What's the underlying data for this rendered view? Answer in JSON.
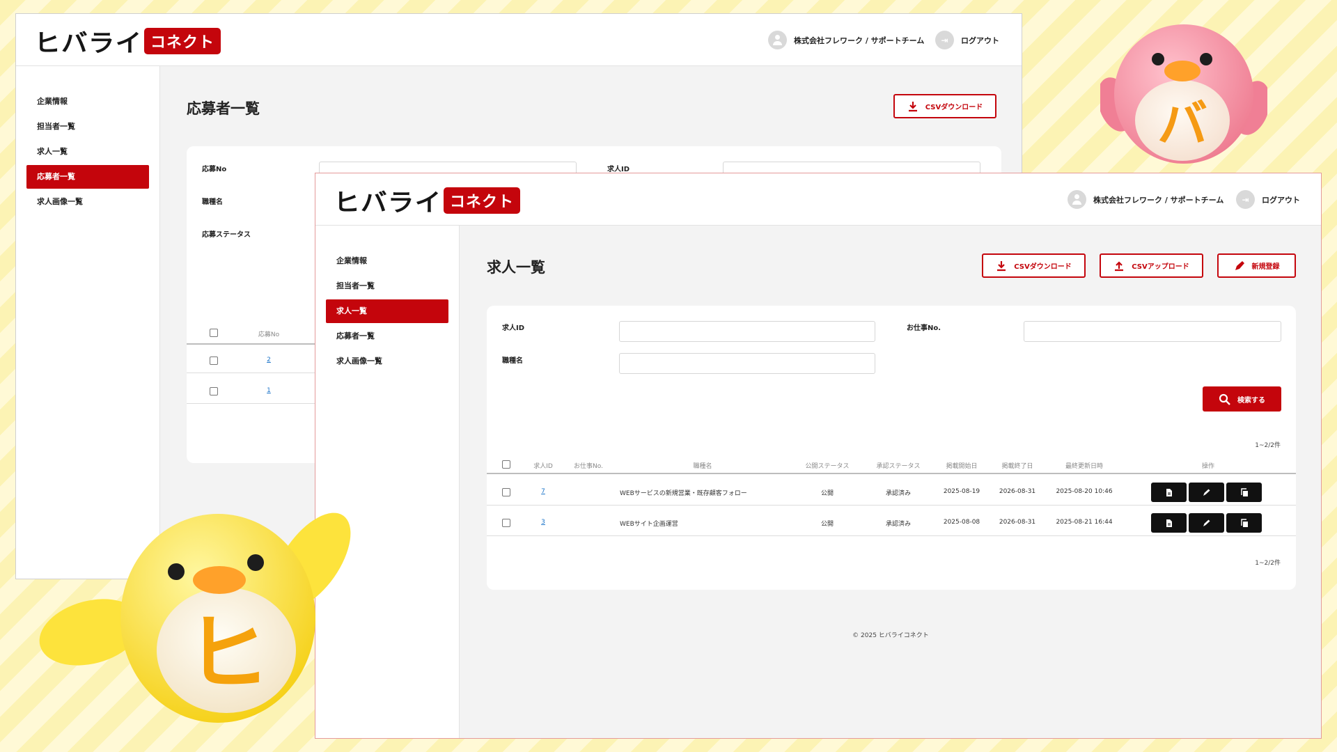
{
  "brand": {
    "name": "ヒバライ",
    "badge": "コネクト",
    "accent": "#c4050c"
  },
  "header": {
    "company": "株式会社フレワーク / サポートチーム",
    "logout": "ログアウト"
  },
  "sidebar": {
    "items": [
      {
        "label": "企業情報"
      },
      {
        "label": "担当者一覧"
      },
      {
        "label": "求人一覧"
      },
      {
        "label": "応募者一覧"
      },
      {
        "label": "求人画像一覧"
      }
    ]
  },
  "back": {
    "active_index": 3,
    "title": "応募者一覧",
    "csv_download": "CSVダウンロード",
    "labels": {
      "apply_no": "応募No",
      "job_id": "求人ID",
      "job_type": "職種名",
      "status": "応募ステータス"
    },
    "table": {
      "col_no": "応募No",
      "rows": [
        {
          "no": "2"
        },
        {
          "no": "1"
        }
      ]
    }
  },
  "front": {
    "active_index": 2,
    "title": "求人一覧",
    "buttons": {
      "csv_download": "CSVダウンロード",
      "csv_upload": "CSVアップロード",
      "new": "新規登録",
      "search": "検索する"
    },
    "filters": {
      "job_id": "求人ID",
      "work_no": "お仕事No.",
      "job_type": "職種名"
    },
    "count": "1~2/2件",
    "table": {
      "headers": [
        "求人ID",
        "お仕事No.",
        "職種名",
        "公開ステータス",
        "承認ステータス",
        "掲載開始日",
        "掲載終了日",
        "最終更新日時",
        "操作"
      ],
      "rows": [
        {
          "id": "7",
          "work_no": "",
          "job": "WEBサービスの新規営業・既存顧客フォロー",
          "public": "公開",
          "approval": "承認済み",
          "start": "2025-08-19",
          "end": "2026-08-31",
          "updated": "2025-08-20 10:46"
        },
        {
          "id": "3",
          "work_no": "",
          "job": "WEBサイト企画運営",
          "public": "公開",
          "approval": "承認済み",
          "start": "2025-08-08",
          "end": "2026-08-31",
          "updated": "2025-08-21 16:44"
        }
      ]
    },
    "footer": "© 2025 ヒバライコネクト"
  },
  "mascots": {
    "pink_letter": "バ",
    "yellow_letter": "ヒ"
  },
  "icons": [
    "user-icon",
    "logout-icon",
    "download-icon",
    "upload-icon",
    "pencil-icon",
    "search-icon",
    "document-icon",
    "copy-icon"
  ]
}
